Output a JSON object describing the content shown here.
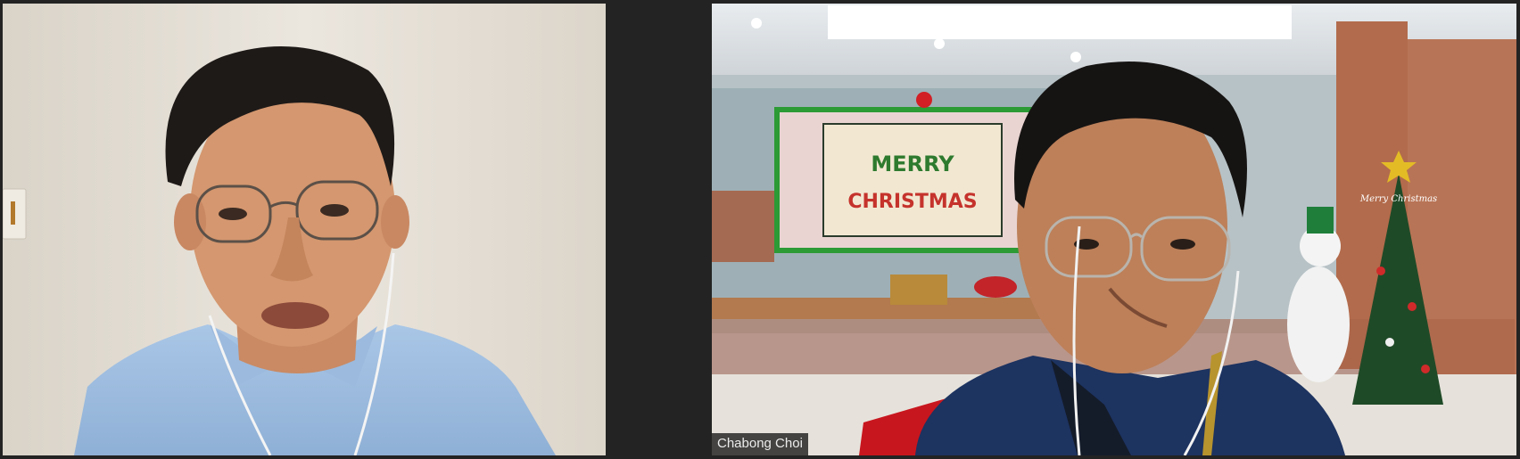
{
  "participants": [
    {
      "position": "left",
      "name": ""
    },
    {
      "position": "right",
      "name": "Chabong Choi"
    }
  ],
  "banner": {
    "line1": "MERRY",
    "line2": "CHRISTMAS"
  },
  "tree_topper_text": "Merry Christmas",
  "colors": {
    "background": "#232323",
    "name_tag_bg": "#161616",
    "name_tag_text": "#ececec"
  }
}
